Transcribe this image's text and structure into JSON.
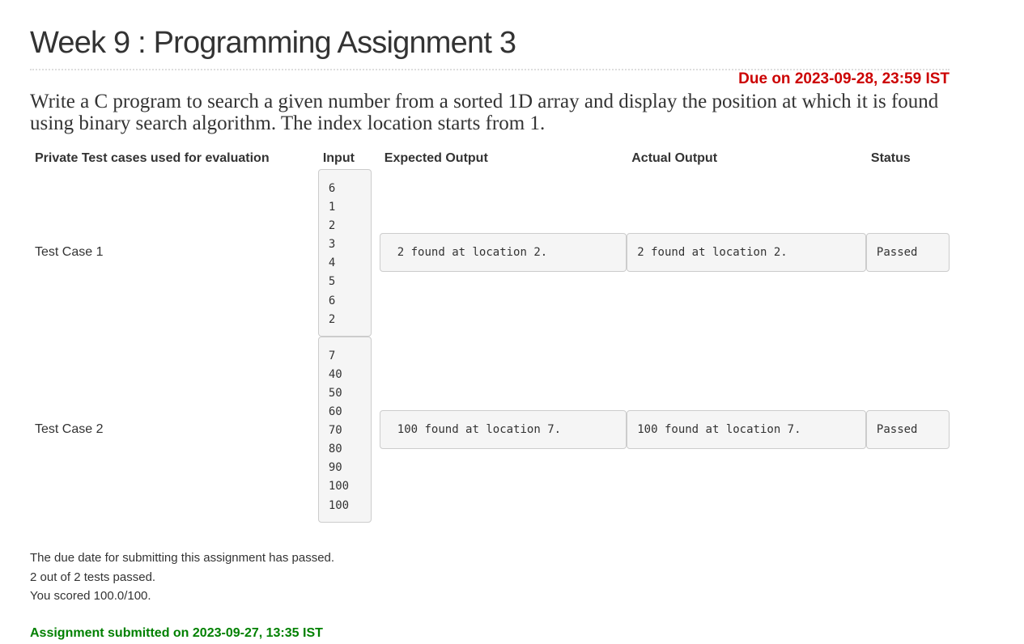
{
  "title": "Week 9 : Programming Assignment 3",
  "due": "Due on 2023-09-28, 23:59 IST",
  "problem": "Write a C program to search a given number from a sorted 1D array and display the position at which it is found using binary search algorithm. The index location starts from 1.",
  "table": {
    "headers": {
      "label": "Private Test cases used for evaluation",
      "input": "Input",
      "expected": "Expected Output",
      "actual": "Actual Output",
      "status": "Status"
    },
    "rows": [
      {
        "label": "Test Case 1",
        "input": "6\n1\n2\n3\n4\n5\n6\n2",
        "expected": "2 found at location 2.",
        "actual": "2 found at location 2.",
        "status": "Passed"
      },
      {
        "label": "Test Case 2",
        "input": "7\n40\n50\n60\n70\n80\n90\n100\n100",
        "expected": "100 found at location 7.",
        "actual": "100 found at location 7.",
        "status": "Passed"
      }
    ]
  },
  "footer": {
    "line1": "The due date for submitting this assignment has passed.",
    "line2": "2 out of 2 tests passed.",
    "line3": "You scored 100.0/100."
  },
  "submitted": "Assignment submitted on 2023-09-27, 13:35 IST",
  "colors": {
    "due": "#cc0000",
    "submitted": "#008000",
    "code_bg": "#f5f5f5",
    "code_border": "#cccccc"
  }
}
